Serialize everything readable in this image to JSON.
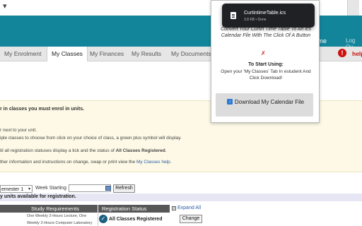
{
  "header": {
    "welcome_fragment": "come",
    "logout_fragment": "Log Ou"
  },
  "nav": {
    "tabs": [
      {
        "label": "My Enrolment"
      },
      {
        "label": "My Classes",
        "active": true
      },
      {
        "label": "My Finances"
      },
      {
        "label": "My Results"
      },
      {
        "label": "My Documents"
      }
    ],
    "help_label": "help",
    "help_icon": "!"
  },
  "notice": {
    "line1": "r in classes you must enrol in units.",
    "line2": "r next to your unit.",
    "line3": "iple classes to choose from click on your choice of class, a green plus symbol will display.",
    "line4_prefix": "til all registration statuses display a tick and the status of ",
    "line4_bold": "All Classes Registered",
    "line4_suffix": ".",
    "line5_prefix": "ther information and instructions on change, swap or print view the ",
    "line5_link": "My Classes help",
    "line5_suffix": "."
  },
  "controls": {
    "semester_value": "emester 1",
    "week_label": "Week Starting",
    "week_value": "",
    "refresh_label": "Refresh",
    "units_text": "y units available for registration."
  },
  "table": {
    "headers": [
      "Study Requirements",
      "Registration Status"
    ],
    "expand_all": "Expand All",
    "expand_symbol": "+",
    "row_line1": "One Weekly 2-Hours Lecture, One",
    "row_line2": "Weekly 2-Hours Computer Laboratory",
    "status": "All Classes Registered",
    "change_label": "Change"
  },
  "popup": {
    "title": "Convert Your Curtin Time Table To An ics Calendar File With The Click Of A Button",
    "start_heading": "To Start Using:",
    "start_body": "Open your 'My Classes' Tab In estudent And Click Download!",
    "download_label": "Download My Calendar File"
  },
  "toast": {
    "filename": "CurtintimeTable.ics",
    "meta": "3.8 KB • Done"
  },
  "colors": {
    "banner": "#13859a",
    "help_red": "#cc1111",
    "toast_bg": "#202124"
  }
}
